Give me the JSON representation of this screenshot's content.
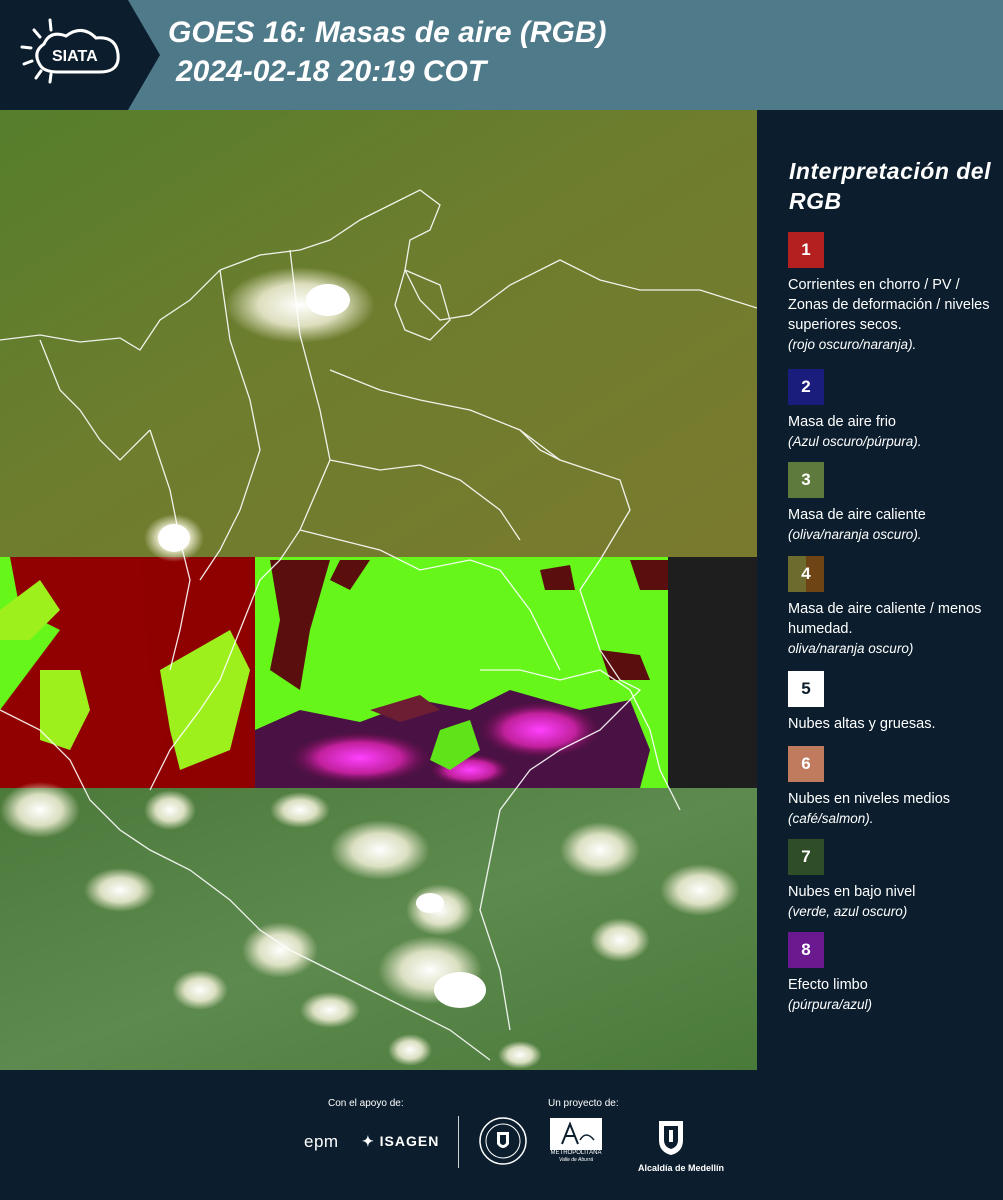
{
  "header": {
    "logo_text": "SIATA",
    "title_line1": "GOES 16: Masas de aire (RGB)",
    "title_line2": "2024-02-18 20:19 COT"
  },
  "legend": {
    "title": "Interpretación del RGB",
    "items": [
      {
        "number": "1",
        "color": "#b3201f",
        "text": "Corrientes en chorro / PV / Zonas de deformación / niveles superiores secos.",
        "sub": "(rojo oscuro/naranja)."
      },
      {
        "number": "2",
        "color": "#1a1d7c",
        "text": "Masa de aire frio",
        "sub": "(Azul oscuro/púrpura)."
      },
      {
        "number": "3",
        "color": "#5e7b3d",
        "text": "Masa de aire caliente",
        "sub": "(oliva/naranja oscuro)."
      },
      {
        "number": "4",
        "color_left": "#6e6b2e",
        "color_right": "#6f4414",
        "text": "Masa de aire caliente / menos humedad.",
        "sub": "oliva/naranja oscuro)"
      },
      {
        "number": "5",
        "color": "#ffffff",
        "text_color": "#0c1e2d",
        "text": "Nubes altas y gruesas.",
        "sub": ""
      },
      {
        "number": "6",
        "color": "#c07a5e",
        "text": "Nubes en niveles medios",
        "sub": "(café/salmon)."
      },
      {
        "number": "7",
        "color": "#2f4d27",
        "text": "Nubes en bajo nivel",
        "sub": "(verde, azul oscuro)"
      },
      {
        "number": "8",
        "color": "#6a198e",
        "text": "Efecto limbo",
        "sub": "(púrpura/azul)"
      }
    ]
  },
  "footer": {
    "support_label": "Con el apoyo de:",
    "project_label": "Un proyecto de:",
    "epm": "epm",
    "isagen": "ISAGEN",
    "area_line1": "METROPOLITANA",
    "area_line2": "Valle de Aburrá",
    "medellin": "Alcaldía de Medellín"
  }
}
